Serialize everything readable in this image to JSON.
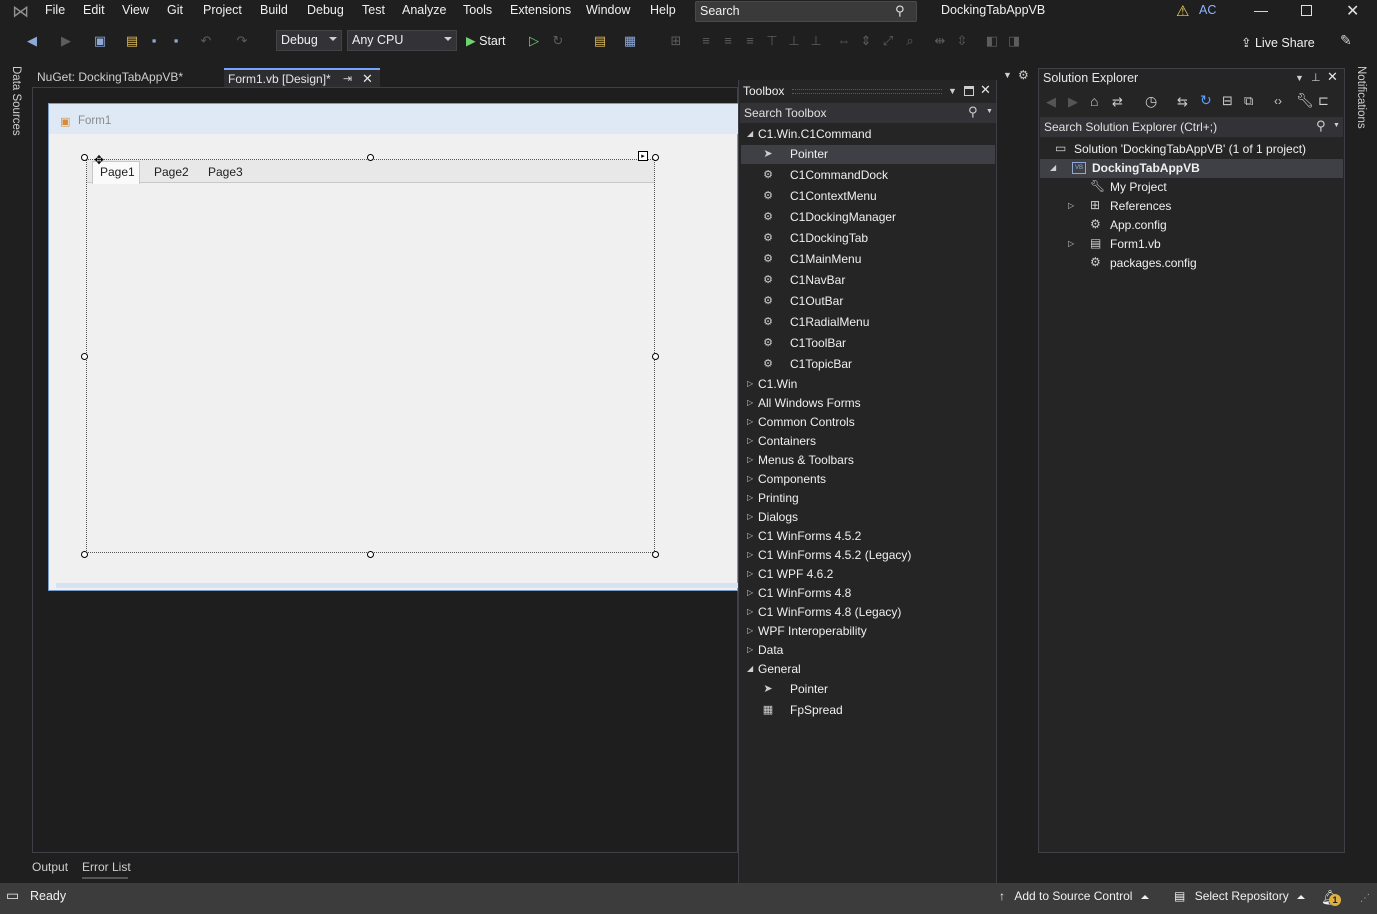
{
  "menubar": {
    "items": [
      "File",
      "Edit",
      "View",
      "Git",
      "Project",
      "Build",
      "Debug",
      "Test",
      "Analyze",
      "Tools",
      "Extensions",
      "Window",
      "Help"
    ],
    "search_label": "Search",
    "app_title": "DockingTabAppVB",
    "account_initials": "AC"
  },
  "toolbar": {
    "config": "Debug",
    "platform": "Any CPU",
    "start_label": "Start",
    "live_share": "Live Share"
  },
  "side_strips": {
    "left": "Data Sources",
    "right": "Notifications"
  },
  "document_tabs": [
    {
      "label": "NuGet: DockingTabAppVB*",
      "active": false
    },
    {
      "label": "Form1.vb [Design]*",
      "active": true
    }
  ],
  "form": {
    "title": "Form1",
    "pages": [
      "Page1",
      "Page2",
      "Page3"
    ]
  },
  "bottom_tabs": [
    "Output",
    "Error List"
  ],
  "toolbox": {
    "title": "Toolbox",
    "search_placeholder": "Search Toolbox",
    "expanded_group": "C1.Win.C1Command",
    "expanded_items": [
      "Pointer",
      "C1CommandDock",
      "C1ContextMenu",
      "C1DockingManager",
      "C1DockingTab",
      "C1MainMenu",
      "C1NavBar",
      "C1OutBar",
      "C1RadialMenu",
      "C1ToolBar",
      "C1TopicBar"
    ],
    "collapsed_groups": [
      "C1.Win",
      "All Windows Forms",
      "Common Controls",
      "Containers",
      "Menus & Toolbars",
      "Components",
      "Printing",
      "Dialogs",
      "C1 WinForms 4.5.2",
      "C1 WinForms 4.5.2 (Legacy)",
      "C1 WPF 4.6.2",
      "C1 WinForms 4.8",
      "C1 WinForms 4.8 (Legacy)",
      "WPF Interoperability",
      "Data"
    ],
    "general_group": "General",
    "general_items": [
      "Pointer",
      "FpSpread"
    ]
  },
  "solution_explorer": {
    "title": "Solution Explorer",
    "search_placeholder": "Search Solution Explorer (Ctrl+;)",
    "solution": "Solution 'DockingTabAppVB' (1 of 1 project)",
    "project": "DockingTabAppVB",
    "items": [
      "My Project",
      "References",
      "App.config",
      "Form1.vb",
      "packages.config"
    ]
  },
  "statusbar": {
    "status": "Ready",
    "source_control": "Add to Source Control",
    "repository": "Select Repository",
    "notification_count": "1"
  }
}
